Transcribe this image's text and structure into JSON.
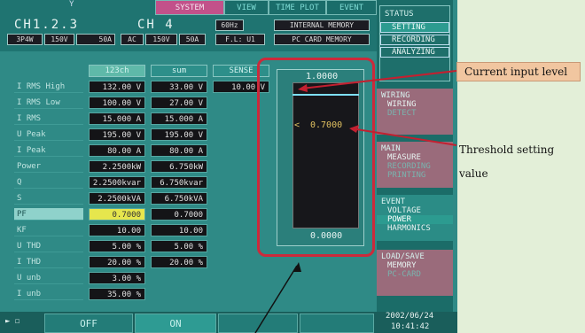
{
  "header": {
    "channel_group": "CH1.2.3",
    "channel4": "CH 4",
    "group_settings": [
      "3P4W",
      "150V",
      "50A"
    ],
    "ch4_settings": [
      "AC",
      "150V",
      "50A"
    ],
    "frequency": "60Hz",
    "sync_source": "F.L: U1",
    "internal_memory": "INTERNAL MEMORY",
    "pc_card_memory": "PC CARD MEMORY"
  },
  "tabs": [
    "SYSTEM",
    "VIEW",
    "TIME PLOT",
    "EVENT"
  ],
  "columns": {
    "ch": "123ch",
    "sum": "sum",
    "sense": "SENSE"
  },
  "rows": [
    {
      "label": "I RMS High",
      "ch": "132.00 V",
      "sum": "33.00 V",
      "sense": "10.00 V"
    },
    {
      "label": "I RMS Low",
      "ch": "100.00 V",
      "sum": "27.00 V",
      "sense": ""
    },
    {
      "label": "I RMS",
      "ch": "15.000 A",
      "sum": "15.000 A",
      "sense": ""
    },
    {
      "label": "U Peak",
      "ch": "195.00 V",
      "sum": "195.00 V",
      "sense": ""
    },
    {
      "label": "I Peak",
      "ch": "80.00 A",
      "sum": "80.00 A",
      "sense": ""
    },
    {
      "label": "Power",
      "ch": "2.2500kW",
      "sum": "6.750kW",
      "sense": ""
    },
    {
      "label": "Q",
      "ch": "2.2500kvar",
      "sum": "6.750kvar",
      "sense": ""
    },
    {
      "label": "S",
      "ch": "2.2500kVA",
      "sum": "6.750kVA",
      "sense": ""
    },
    {
      "label": "PF",
      "ch": "0.7000",
      "sum": "0.7000",
      "sense": ""
    },
    {
      "label": "KF",
      "ch": "10.00",
      "sum": "10.00",
      "sense": ""
    },
    {
      "label": "U THD",
      "ch": "5.00 %",
      "sum": "5.00 %",
      "sense": ""
    },
    {
      "label": "I THD",
      "ch": "20.00 %",
      "sum": "20.00 %",
      "sense": ""
    },
    {
      "label": "U unb",
      "ch": "3.00 %",
      "sum": "",
      "sense": ""
    },
    {
      "label": "I unb",
      "ch": "35.00 %",
      "sum": "",
      "sense": ""
    }
  ],
  "gauge": {
    "top_value": "1.0000",
    "bottom_value": "0.0000",
    "threshold_marker": "<",
    "threshold_value": "0.7000",
    "input_level": 0.92,
    "threshold_level": 0.7
  },
  "sidebar": {
    "status": {
      "title": "STATUS",
      "items": [
        "SETTING",
        "RECORDING",
        "ANALYZING"
      ]
    },
    "wiring": {
      "title": "WIRING",
      "items": [
        "WIRING",
        "DETECT"
      ]
    },
    "main": {
      "title": "MAIN",
      "items": [
        "MEASURE",
        "RECORDING",
        "PRINTING"
      ]
    },
    "event": {
      "title": "EVENT",
      "items": [
        "VOLTAGE",
        "POWER",
        "HARMONICS"
      ]
    },
    "loadsave": {
      "title": "LOAD/SAVE",
      "items": [
        "MEMORY",
        "PC-CARD"
      ]
    }
  },
  "footer": {
    "icon_text": "► ☐",
    "keys": [
      "OFF",
      "ON",
      "",
      ""
    ],
    "date": "2002/06/24",
    "time": "10:41:42"
  },
  "annotations": {
    "current_input_level": "Current input level",
    "threshold_line1": "Threshold setting",
    "threshold_line2": "value"
  }
}
